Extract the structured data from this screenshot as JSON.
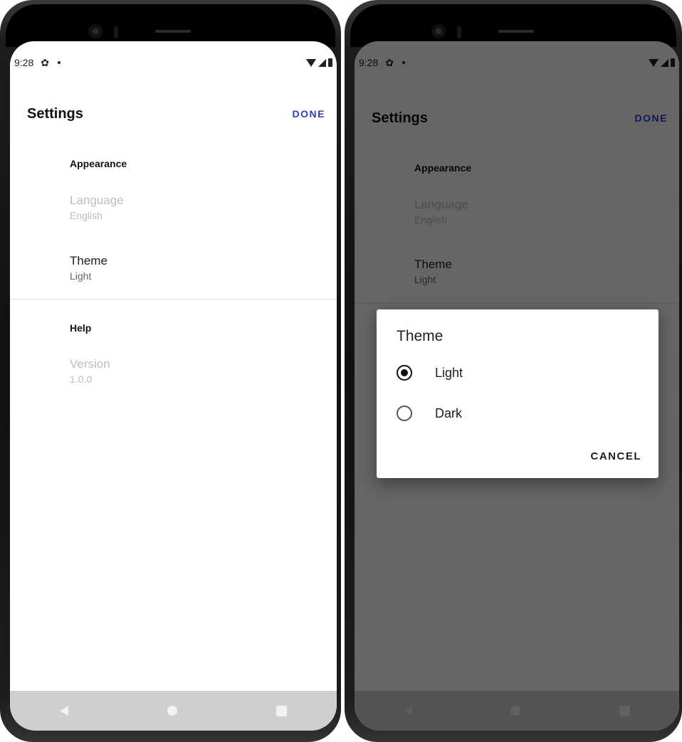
{
  "status_bar": {
    "time": "9:28",
    "gear_icon": "gear-icon",
    "wifi_icon": "wifi-icon",
    "signal_icon": "signal-icon",
    "battery_icon": "battery-icon"
  },
  "appbar": {
    "title": "Settings",
    "done_label": "DONE"
  },
  "sections": {
    "appearance": "Appearance",
    "help": "Help"
  },
  "prefs": {
    "language": {
      "title": "Language",
      "value": "English"
    },
    "theme": {
      "title": "Theme",
      "value": "Light"
    },
    "version": {
      "title": "Version",
      "value": "1.0.0"
    }
  },
  "dialog": {
    "title": "Theme",
    "options": [
      {
        "label": "Light",
        "selected": true
      },
      {
        "label": "Dark",
        "selected": false
      }
    ],
    "cancel_label": "CANCEL"
  },
  "colors": {
    "accent": "#2c3bd6",
    "navbar": "#cfcfcf",
    "disabled_text": "#bdbdbd"
  }
}
